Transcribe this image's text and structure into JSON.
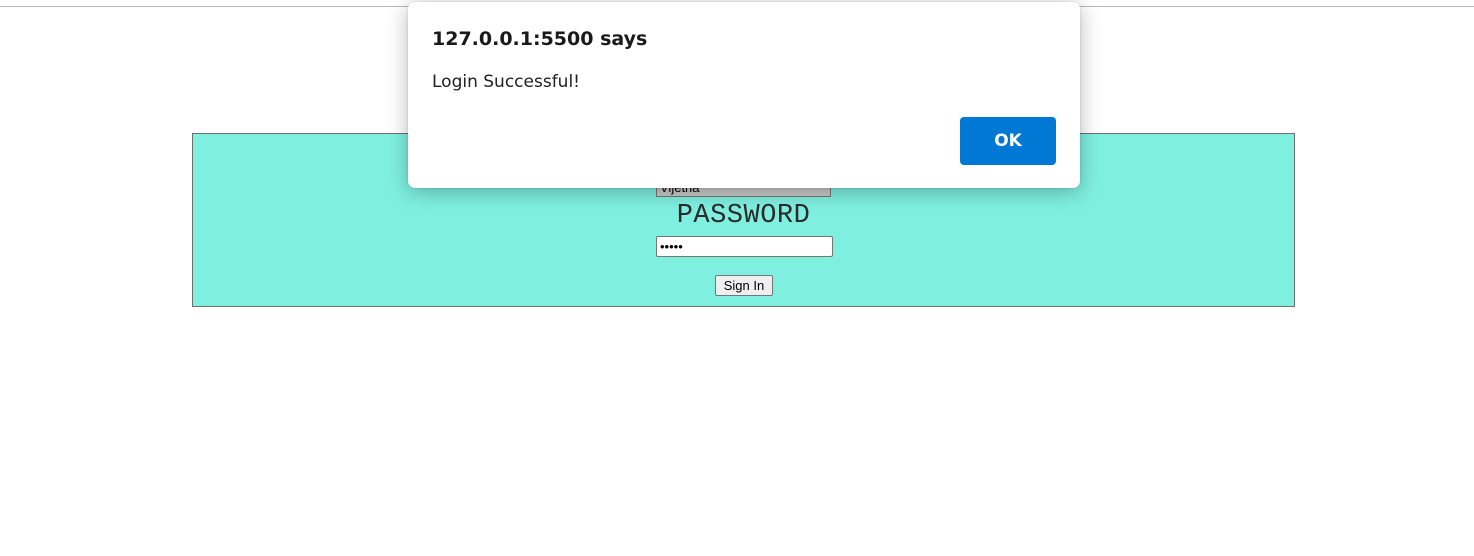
{
  "login_form": {
    "username_value": "Vijetha",
    "password_label": "PASSWORD",
    "password_value": "•••••",
    "signin_label": "Sign In"
  },
  "alert": {
    "title": "127.0.0.1:5500 says",
    "message": "Login Successful!",
    "ok_label": "OK"
  },
  "colors": {
    "panel_background": "#7ff0e0",
    "ok_button": "#0078d4"
  }
}
